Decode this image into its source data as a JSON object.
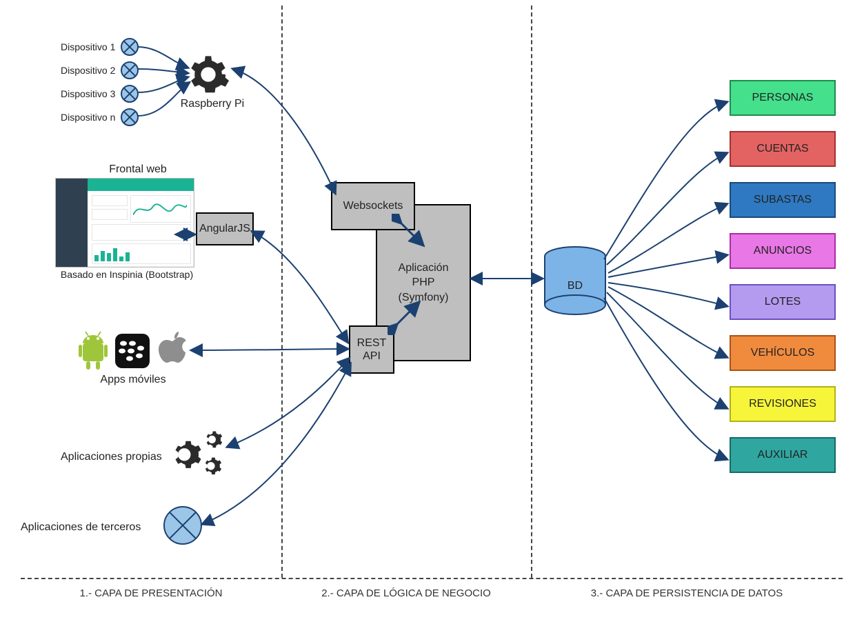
{
  "layers": {
    "presentation": "1.- CAPA DE PRESENTACIÓN",
    "logic": "2.- CAPA DE LÓGICA DE NEGOCIO",
    "persistence": "3.- CAPA DE PERSISTENCIA DE DATOS"
  },
  "presentation": {
    "devices": {
      "items": [
        {
          "label": "Dispositivo 1"
        },
        {
          "label": "Dispositivo 2"
        },
        {
          "label": "Dispositivo 3"
        },
        {
          "label": "Dispositivo n"
        }
      ]
    },
    "raspberry_label": "Raspberry Pi",
    "frontal_title": "Frontal web",
    "frontal_caption": "Basado en Inspinia (Bootstrap)",
    "angular_label": "AngularJS",
    "apps_moviles_label": "Apps móviles",
    "own_apps_label": "Aplicaciones propias",
    "third_party_label": "Aplicaciones de terceros"
  },
  "logic": {
    "websockets_label": "Websockets",
    "rest_api_label": "REST API",
    "php_line1": "Aplicación",
    "php_line2": "PHP",
    "php_line3": "(Symfony)"
  },
  "persistence": {
    "db_label": "BD",
    "tables": [
      {
        "label": "PERSONAS",
        "bg": "#44e08b",
        "border": "#1e8b4e"
      },
      {
        "label": "CUENTAS",
        "bg": "#e36363",
        "border": "#a33030"
      },
      {
        "label": "SUBASTAS",
        "bg": "#2e79c1",
        "border": "#184a7d"
      },
      {
        "label": "ANUNCIOS",
        "bg": "#e977e6",
        "border": "#a72fa3"
      },
      {
        "label": "LOTES",
        "bg": "#b49bf0",
        "border": "#6a4fc0"
      },
      {
        "label": "VEHÍCULOS",
        "bg": "#f08b3e",
        "border": "#a85315"
      },
      {
        "label": "REVISIONES",
        "bg": "#f7f53a",
        "border": "#b3b017"
      },
      {
        "label": "AUXILIAR",
        "bg": "#2fa6a0",
        "border": "#176965"
      }
    ]
  },
  "icons": {
    "gear": "gear-icon",
    "android": "android-icon",
    "blackberry": "blackberry-icon",
    "apple": "apple-icon",
    "gears_cluster": "gears-cluster-icon",
    "cross_circle": "cross-circle-icon",
    "double_arrow": "double-arrow-icon",
    "database": "database-icon"
  }
}
